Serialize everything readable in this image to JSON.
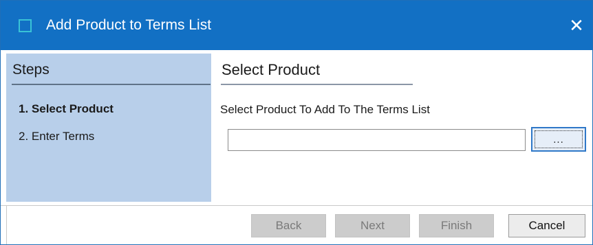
{
  "window": {
    "title": "Add Product to Terms List",
    "close_glyph": "✕"
  },
  "steps": {
    "title": "Steps",
    "items": [
      {
        "label": "1. Select Product",
        "active": true
      },
      {
        "label": "2. Enter Terms",
        "active": false
      }
    ]
  },
  "main": {
    "section_title": "Select Product",
    "prompt": "Select Product To Add To The Terms List",
    "product_value": "",
    "browse_label": "..."
  },
  "footer": {
    "back_label": "Back",
    "next_label": "Next",
    "finish_label": "Finish",
    "cancel_label": "Cancel"
  },
  "colors": {
    "titlebar": "#1270c4",
    "steps_panel": "#b8cfea",
    "icon_accent": "#39c3d6"
  },
  "icons": {
    "window_icon": "window-icon",
    "close": "close-icon"
  }
}
